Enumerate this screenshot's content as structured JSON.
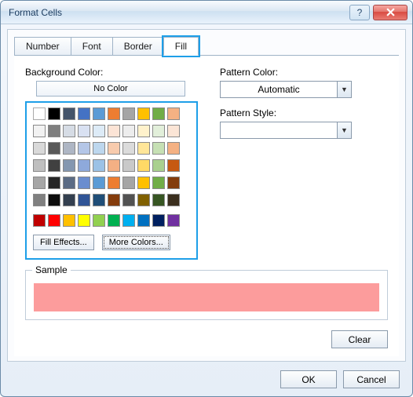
{
  "window": {
    "title": "Format Cells"
  },
  "tabs": {
    "number": "Number",
    "font": "Font",
    "border": "Border",
    "fill": "Fill"
  },
  "labels": {
    "background_color": "Background Color:",
    "no_color": "No Color",
    "pattern_color": "Pattern Color:",
    "pattern_style": "Pattern Style:",
    "sample": "Sample"
  },
  "buttons": {
    "fill_effects": "Fill Effects...",
    "more_colors": "More Colors...",
    "clear": "Clear",
    "ok": "OK",
    "cancel": "Cancel"
  },
  "combos": {
    "pattern_color_value": "Automatic",
    "pattern_style_value": ""
  },
  "sample_color": "#fc9c9c",
  "palette": {
    "theme_row": [
      "#ffffff",
      "#000000",
      "#44546a",
      "#4472c4",
      "#5b9bd5",
      "#ed7d31",
      "#a5a5a5",
      "#ffc000",
      "#70ad47",
      "#f4b183"
    ],
    "tints": [
      [
        "#f2f2f2",
        "#7f7f7f",
        "#d6dce5",
        "#d9e1f2",
        "#ddebf7",
        "#fce4d6",
        "#ededed",
        "#fff2cc",
        "#e2efda",
        "#fbe5d6"
      ],
      [
        "#d9d9d9",
        "#595959",
        "#aeb6c4",
        "#b4c6e7",
        "#bdd7ee",
        "#f8cbad",
        "#dbdbdb",
        "#ffe699",
        "#c6e0b4",
        "#f4b183"
      ],
      [
        "#bfbfbf",
        "#404040",
        "#8497b0",
        "#8ea9db",
        "#9bc2e6",
        "#f4b084",
        "#c9c9c9",
        "#ffd966",
        "#a9d08e",
        "#c65911"
      ],
      [
        "#a6a6a6",
        "#262626",
        "#5b6b84",
        "#6a8dcf",
        "#5b9bd5",
        "#ed7d31",
        "#a5a5a5",
        "#ffc000",
        "#70ad47",
        "#833c0c"
      ],
      [
        "#808080",
        "#0d0d0d",
        "#333f4f",
        "#305496",
        "#1f4e78",
        "#843c0c",
        "#525252",
        "#806000",
        "#375623",
        "#3b2f1e"
      ]
    ],
    "standard": [
      "#c00000",
      "#ff0000",
      "#ffc000",
      "#ffff00",
      "#92d050",
      "#00b050",
      "#00b0f0",
      "#0070c0",
      "#002060",
      "#7030a0"
    ]
  }
}
